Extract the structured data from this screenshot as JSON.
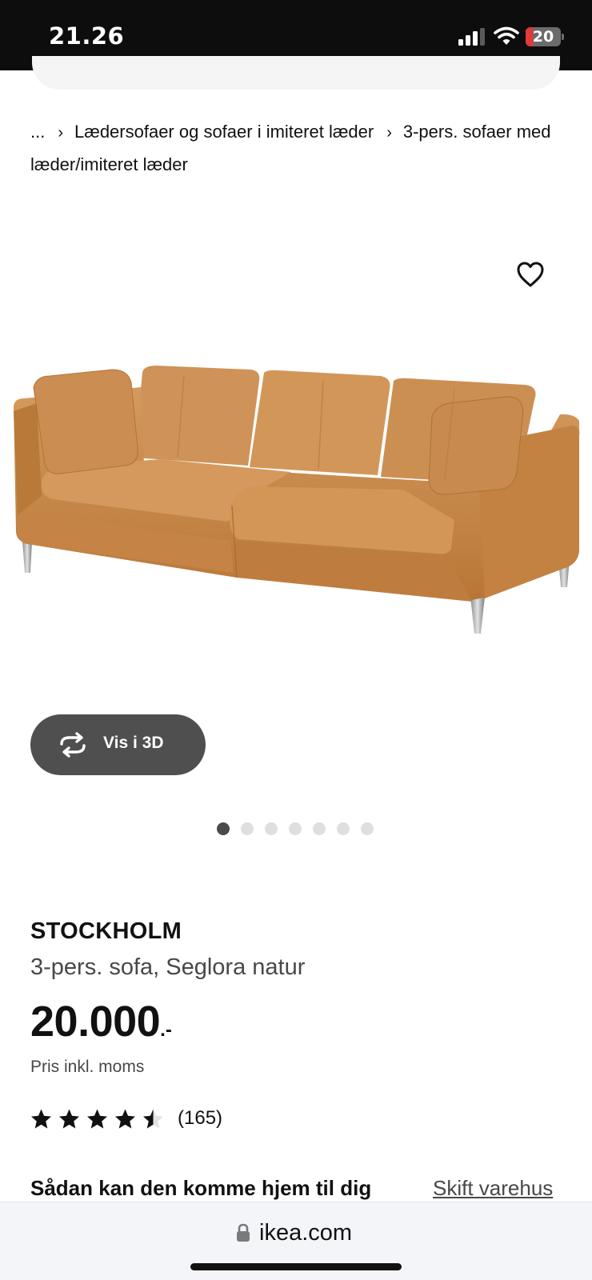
{
  "status_bar": {
    "time": "21.26",
    "battery_level": "20",
    "battery_fraction": 0.2,
    "signal_bars": 3
  },
  "breadcrumb": {
    "ellipsis": "...",
    "items": [
      "Lædersofaer og sofaer i imiteret læder",
      "3-pers. sofaer med læder/imiteret læder"
    ]
  },
  "product": {
    "image_icon": "sofa-image",
    "favorite_icon": "heart-icon",
    "view3d_label": "Vis i 3D",
    "view3d_icon": "rotate-3d-icon",
    "gallery_count": 7,
    "gallery_active": 0,
    "name": "STOCKHOLM",
    "description": "3-pers. sofa, Seglora natur",
    "price_amount": "20.000",
    "price_suffix": ".-",
    "price_note": "Pris inkl. moms",
    "rating_value": 4.5,
    "rating_max": 5,
    "review_count": "(165)"
  },
  "delivery": {
    "title": "Sådan kan den komme hjem til dig",
    "change_store_link": "Skift varehus"
  },
  "browser": {
    "url": "ikea.com",
    "lock_icon": "lock-icon"
  },
  "colors": {
    "leather": "#c98a4b",
    "button_dark": "#4f4f4f",
    "battery_low": "#e53935"
  }
}
